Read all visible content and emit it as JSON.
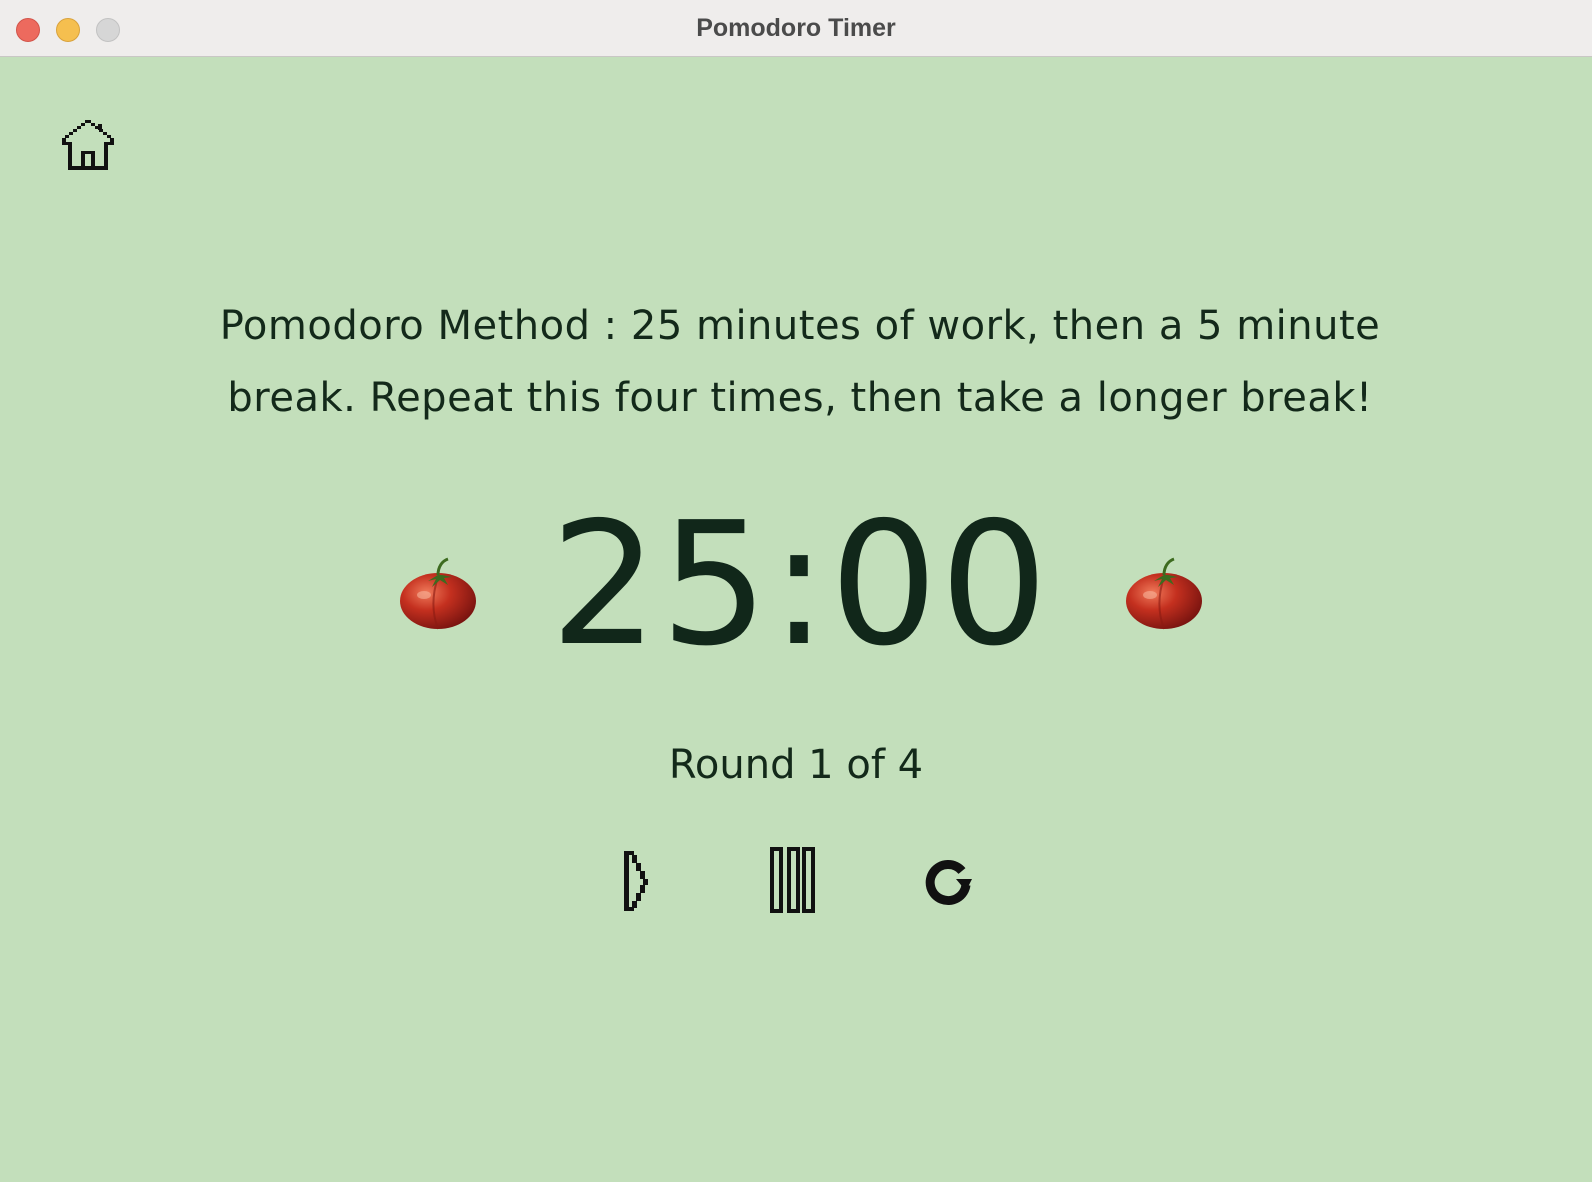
{
  "window": {
    "title": "Pomodoro Timer"
  },
  "toolbar": {
    "home_icon": "home-icon"
  },
  "main": {
    "description": "Pomodoro Method : 25 minutes of work, then a 5 minute break. Repeat this four times, then take a longer break!",
    "timer": "25:00",
    "round": "Round 1 of 4",
    "decor_icons": [
      "tomato-icon",
      "tomato-icon"
    ]
  },
  "controls": {
    "icons": [
      "play-icon",
      "pause-icon",
      "reset-icon"
    ]
  },
  "colors": {
    "background": "#c3dfbb",
    "text": "#13291a",
    "titlebar": "#efedec",
    "tomato": "#c4301f"
  }
}
